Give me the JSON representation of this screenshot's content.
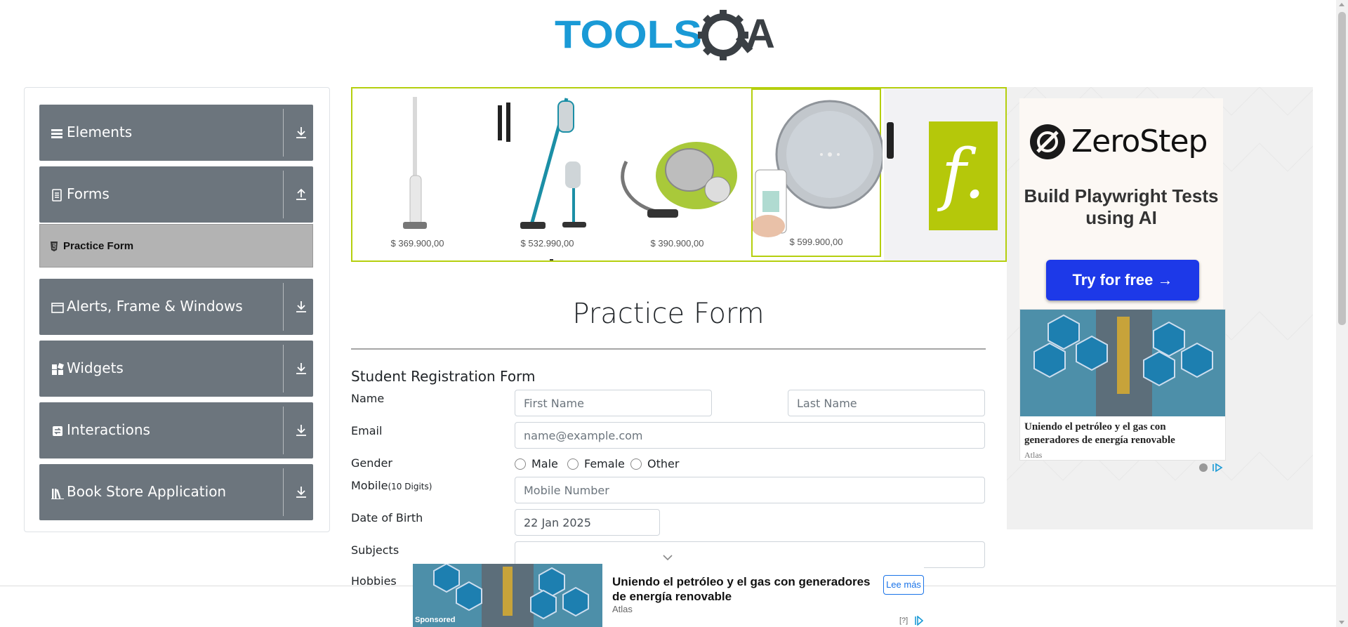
{
  "header": {
    "logo_alt": "TOOLSQA"
  },
  "sidebar": {
    "groups": [
      {
        "label": "Elements",
        "icon": "hamburger-icon",
        "expanded": false
      },
      {
        "label": "Forms",
        "icon": "document-icon",
        "expanded": true
      },
      {
        "label": "Alerts, Frame & Windows",
        "icon": "window-icon",
        "expanded": false
      },
      {
        "label": "Widgets",
        "icon": "widgets-icon",
        "expanded": false
      },
      {
        "label": "Interactions",
        "icon": "interactions-icon",
        "expanded": false
      },
      {
        "label": "Book Store Application",
        "icon": "books-icon",
        "expanded": false
      }
    ],
    "active_item": {
      "label": "Practice Form",
      "icon": "html5-icon"
    }
  },
  "banner_ad": {
    "products": [
      {
        "name": "stick-vacuum",
        "price": "$ 369.900,00"
      },
      {
        "name": "cordless-vacuum",
        "price": "$ 532.990,00"
      },
      {
        "name": "canister-vacuum",
        "price": "$ 390.900,00"
      },
      {
        "name": "robot-vacuum",
        "price": "$ 599.900,00"
      }
    ],
    "brand_logo": "f.",
    "accent_color": "#b5cf0e"
  },
  "main": {
    "title": "Practice Form",
    "form_heading": "Student Registration Form",
    "labels": {
      "name": "Name",
      "email": "Email",
      "gender": "Gender",
      "mobile": "Mobile",
      "mobile_hint": "(10 Digits)",
      "dob": "Date of Birth",
      "subjects": "Subjects",
      "hobbies": "Hobbies"
    },
    "fields": {
      "first_name_placeholder": "First Name",
      "last_name_placeholder": "Last Name",
      "email_placeholder": "name@example.com",
      "mobile_placeholder": "Mobile Number",
      "dob_value": "22 Jan 2025"
    },
    "gender_options": [
      "Male",
      "Female",
      "Other"
    ]
  },
  "right_ad": {
    "brand": "ZeroStep",
    "tagline": "Build Playwright Tests using AI",
    "cta": "Try for free →",
    "cta_color": "#1d39e8",
    "card_title": "Uniendo el petróleo y el gas con generadores de energía renovable",
    "card_source": "Atlas"
  },
  "bottom_ad": {
    "sponsored": "Sponsored",
    "title": "Uniendo el petróleo y el gas con generadores de energía renovable",
    "source": "Atlas",
    "cta": "Lee más",
    "help": "[?]"
  },
  "colors": {
    "sidebar_group": "#6c757d",
    "active_item": "#b3b3b3",
    "logo_blue": "#1a9ad6",
    "logo_dark": "#3a3f44"
  }
}
